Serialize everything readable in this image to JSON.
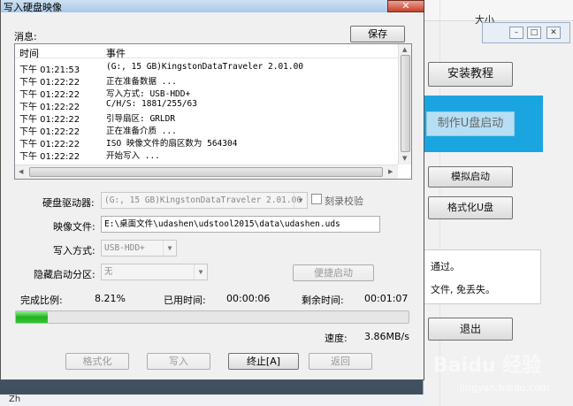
{
  "dialog": {
    "title": "写入硬盘映像",
    "close_label": "✕",
    "messages_label": "消息:",
    "save_label": "保存",
    "log": {
      "columns": [
        "时间",
        "事件"
      ],
      "rows": [
        {
          "time": "下午 01:21:53",
          "event": "(G:, 15 GB)KingstonDataTraveler 2.01.00"
        },
        {
          "time": "下午 01:22:22",
          "event": "正在准备数据 ..."
        },
        {
          "time": "下午 01:22:22",
          "event": "写入方式: USB-HDD+"
        },
        {
          "time": "下午 01:22:22",
          "event": "C/H/S: 1881/255/63"
        },
        {
          "time": "下午 01:22:22",
          "event": "引导扇区: GRLDR"
        },
        {
          "time": "下午 01:22:22",
          "event": "正在准备介质 ..."
        },
        {
          "time": "下午 01:22:22",
          "event": "ISO 映像文件的扇区数为 564304"
        },
        {
          "time": "下午 01:22:22",
          "event": "开始写入 ..."
        }
      ]
    },
    "drive_label": "硬盘驱动器:",
    "drive_value": "(G:, 15 GB)KingstonDataTraveler 2.01.00",
    "verify_label": "刻录校验",
    "image_label": "映像文件:",
    "image_value": "E:\\桌面文件\\udashen\\udstool2015\\data\\udashen.uds",
    "write_mode_label": "写入方式:",
    "write_mode_value": "USB-HDD+",
    "hidden_partition_label": "隐藏启动分区:",
    "hidden_partition_value": "无",
    "quick_boot_label": "便捷启动",
    "progress_label": "完成比例:",
    "progress_value": "8.21%",
    "progress_fraction": 0.0821,
    "elapsed_label": "已用时间:",
    "elapsed_value": "00:00:06",
    "remaining_label": "剩余时间:",
    "remaining_value": "00:01:07",
    "speed_label": "速度:",
    "speed_value": "3.86MB/s",
    "buttons": {
      "format": "格式化",
      "write": "写入",
      "stop": "终止[A]",
      "back": "返回"
    }
  },
  "background_window": {
    "column_header": "大小",
    "install_tutorial": "安装教程",
    "make_usb": "制作U盘启动",
    "simulate_boot": "模拟启动",
    "format_usb": "格式化U盘",
    "info_line1": "通过。",
    "info_line2": "文件, 免丢失。",
    "exit": "退出"
  },
  "watermark": {
    "logo": "Baidu 经验",
    "url": "jingyan.baidu.com"
  },
  "taskbar_text": "Zh"
}
